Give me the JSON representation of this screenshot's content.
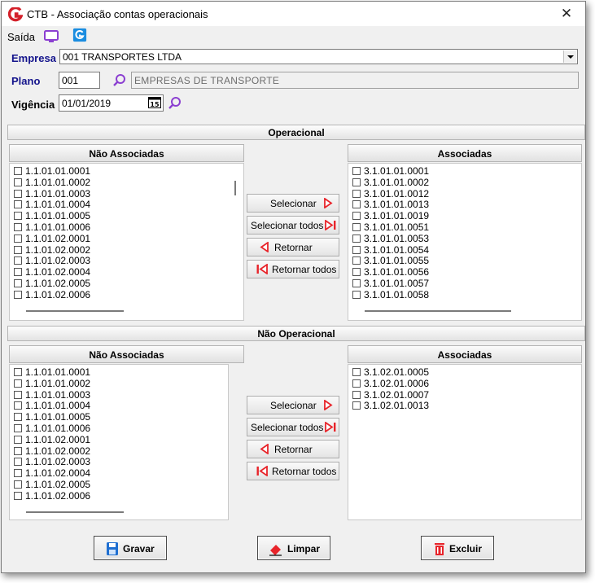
{
  "window": {
    "title": "CTB - Associação contas operacionais",
    "close_label": "✕"
  },
  "toolbar": {
    "saida_label": "Saída",
    "icons": [
      "monitor-icon",
      "app-logo-icon"
    ]
  },
  "form": {
    "empresa_label": "Empresa",
    "empresa_value": "001 TRANSPORTES LTDA",
    "plano_label": "Plano",
    "plano_code": "001",
    "plano_description": "EMPRESAS DE TRANSPORTE",
    "vigencia_label": "Vigência",
    "vigencia_value": "01/01/2019"
  },
  "operacional": {
    "title": "Operacional",
    "nao_associadas_title": "Não Associadas",
    "associadas_title": "Associadas",
    "nao_associadas": [
      "1.1.01.01.0001",
      "1.1.01.01.0002",
      "1.1.01.01.0003",
      "1.1.01.01.0004",
      "1.1.01.01.0005",
      "1.1.01.01.0006",
      "1.1.01.02.0001",
      "1.1.01.02.0002",
      "1.1.01.02.0003",
      "1.1.01.02.0004",
      "1.1.01.02.0005",
      "1.1.01.02.0006"
    ],
    "associadas": [
      "3.1.01.01.0001",
      "3.1.01.01.0002",
      "3.1.01.01.0012",
      "3.1.01.01.0013",
      "3.1.01.01.0019",
      "3.1.01.01.0051",
      "3.1.01.01.0053",
      "3.1.01.01.0054",
      "3.1.01.01.0055",
      "3.1.01.01.0056",
      "3.1.01.01.0057",
      "3.1.01.01.0058"
    ],
    "buttons": {
      "selecionar": "Selecionar",
      "selecionar_todos": "Selecionar todos",
      "retornar": "Retornar",
      "retornar_todos": "Retornar todos"
    }
  },
  "nao_operacional": {
    "title": "Não Operacional",
    "nao_associadas_title": "Não Associadas",
    "associadas_title": "Associadas",
    "nao_associadas": [
      "1.1.01.01.0001",
      "1.1.01.01.0002",
      "1.1.01.01.0003",
      "1.1.01.01.0004",
      "1.1.01.01.0005",
      "1.1.01.01.0006",
      "1.1.01.02.0001",
      "1.1.01.02.0002",
      "1.1.01.02.0003",
      "1.1.01.02.0004",
      "1.1.01.02.0005",
      "1.1.01.02.0006"
    ],
    "associadas": [
      "3.1.02.01.0005",
      "3.1.02.01.0006",
      "3.1.02.01.0007",
      "3.1.02.01.0013"
    ],
    "buttons": {
      "selecionar": "Selecionar",
      "selecionar_todos": "Selecionar todos",
      "retornar": "Retornar",
      "retornar_todos": "Retornar todos"
    }
  },
  "actions": {
    "gravar": "Gravar",
    "limpar": "Limpar",
    "excluir": "Excluir"
  },
  "colors": {
    "label_blue": "#14148c",
    "arrow_red": "#e8242a",
    "accent_purple": "#8b3fd1",
    "logo_blue": "#1b8de0"
  }
}
